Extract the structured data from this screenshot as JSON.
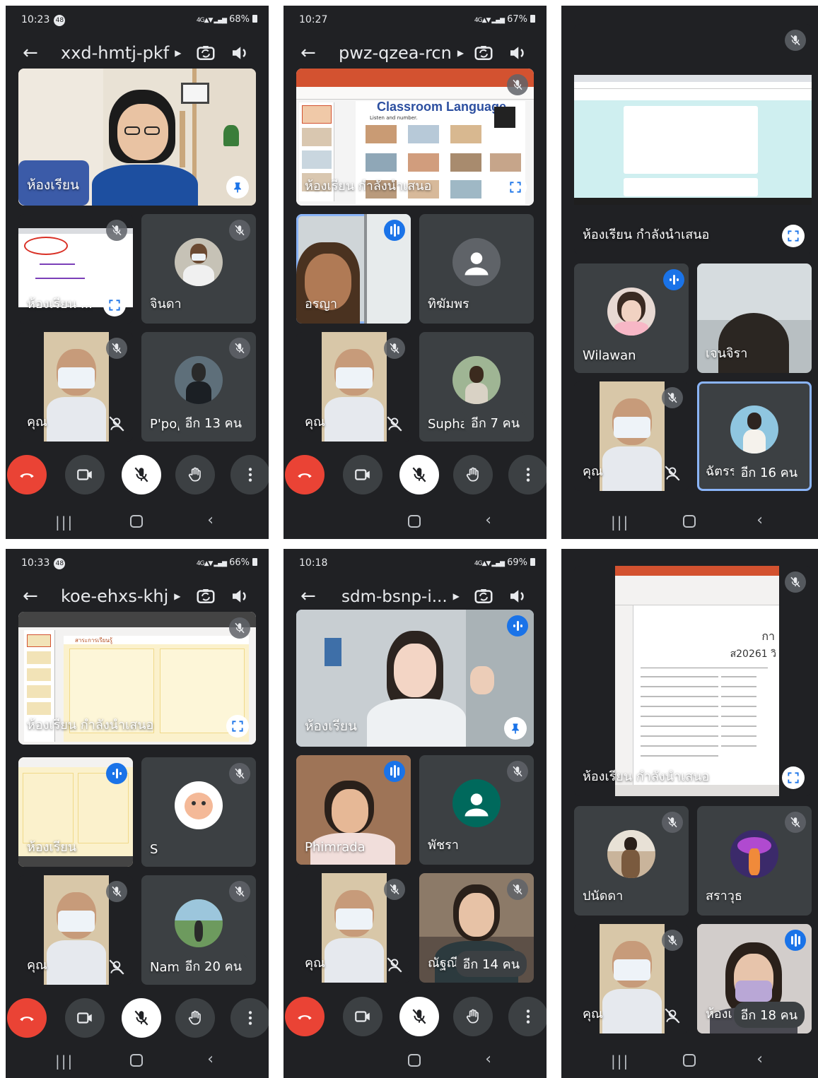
{
  "screens": [
    {
      "time": "10:23",
      "notification": "48",
      "battery": "68%",
      "meeting_code": "xxd-hmtj-pkf",
      "tiles": {
        "main_name": "ห้องเรียน",
        "t1_name": "ห้องเรียน ...",
        "t2_name": "จินดา",
        "t3_name": "คุณ",
        "t4_name": "P'pop",
        "more": "อีก 13 คน"
      }
    },
    {
      "time": "10:27",
      "battery": "67%",
      "meeting_code": "pwz-qzea-rcn",
      "slide_title": "Classroom Language",
      "slide_subtitle": "Listen and number.",
      "tiles": {
        "main_name": "ห้องเรียน กำลังนำเสนอ",
        "t1_name": "อรญา",
        "t2_name": "ทิฆัมพร",
        "t3_name": "คุณ",
        "t4_name": "Supha",
        "more": "อีก 7 คน"
      }
    },
    {
      "tiles": {
        "main_name": "ห้องเรียน กำลังนำเสนอ",
        "t1_name": "Wilawan",
        "t2_name": "เจนจิรา",
        "t3_name": "คุณ",
        "t4_name": "ฉัตรร",
        "more": "อีก 16 คน"
      }
    },
    {
      "time": "10:33",
      "notification": "48",
      "battery": "66%",
      "meeting_code": "koe-ehxs-khj",
      "slide_title": "สาระการเรียนรู้",
      "tiles": {
        "main_name": "ห้องเรียน กำลังนำเสนอ",
        "t1_name": "ห้องเรียน",
        "t2_name": "S",
        "t3_name": "คุณ",
        "t4_name": "Nam",
        "more": "อีก 20 คน"
      }
    },
    {
      "time": "10:18",
      "battery": "69%",
      "meeting_code": "sdm-bsnp-i...",
      "tiles": {
        "main_name": "ห้องเรียน",
        "t1_name": "Phimrada",
        "t2_name": "พัชรา",
        "t3_name": "คุณ",
        "t4_name": "ณัฐณี",
        "more": "อีก 14 คน"
      }
    },
    {
      "doc_heading": "กา",
      "doc_code": "ส20261 วิ",
      "tiles": {
        "main_name": "ห้องเรียน กำลังนำเสนอ",
        "t1_name": "ปนัดดา",
        "t2_name": "สราวุธ",
        "t3_name": "คุณ",
        "t4_name": "ห้องเ",
        "more": "อีก 18 คน"
      }
    }
  ],
  "colors": {
    "background": "#202124",
    "tile": "#3c4043",
    "end_call": "#ea4335",
    "speaking": "#1a73e8",
    "active_outline": "#8ab4f8"
  },
  "icons": [
    "back-arrow-icon",
    "switch-camera-icon",
    "speaker-icon",
    "mic-off-icon",
    "pin-icon",
    "fullscreen-icon",
    "end-call-icon",
    "camera-icon",
    "raise-hand-icon",
    "more-vert-icon",
    "speaking-icon",
    "no-effects-icon"
  ]
}
